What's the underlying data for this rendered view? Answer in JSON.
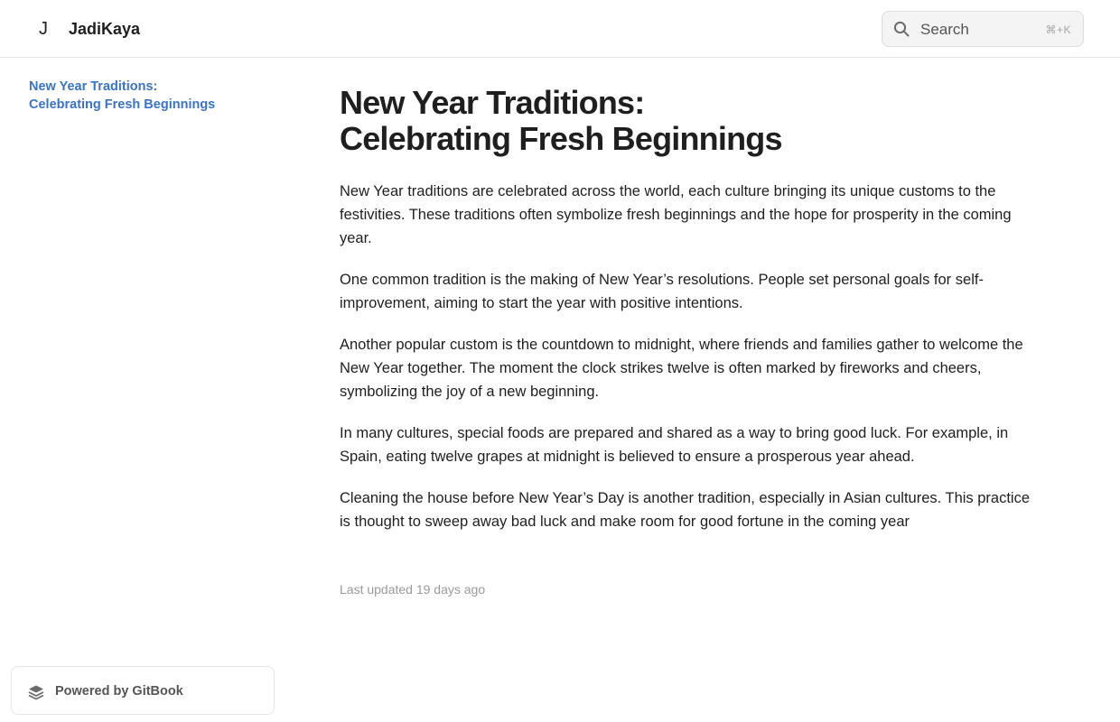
{
  "header": {
    "logo_glyph": "J",
    "site_title": "JadiKaya",
    "search": {
      "placeholder": "Search",
      "shortcut": "⌘+K",
      "icon": "search-icon"
    }
  },
  "sidebar": {
    "active_color": "#3b74c7",
    "items": [
      {
        "label_line1": "New Year Traditions:",
        "label_line2": "Celebrating Fresh Beginnings",
        "active": true
      }
    ],
    "powered_by": {
      "label": "Powered by GitBook",
      "icon": "gitbook-icon"
    }
  },
  "main": {
    "title_line1": "New Year Traditions:",
    "title_line2": "Celebrating Fresh Beginnings",
    "paragraphs": [
      "New Year traditions are celebrated across the world, each culture bringing its unique customs to the festivities. These traditions often symbolize fresh beginnings and the hope for prosperity in the coming year.",
      "One common tradition is the making of New Year’s resolutions. People set personal goals for self-improvement, aiming to start the year with positive intentions.",
      "Another popular custom is the countdown to midnight, where friends and families gather to welcome the New Year together. The moment the clock strikes twelve is often marked by fireworks and cheers, symbolizing the joy of a new beginning.",
      "In many cultures, special foods are prepared and shared as a way to bring good luck. For example, in Spain, eating twelve grapes at midnight is believed to ensure a prosperous year ahead.",
      "Cleaning the house before New Year’s Day is another tradition, especially in Asian cultures. This practice is thought to sweep away bad luck and make room for good fortune in the coming year"
    ],
    "last_updated": "Last updated 19 days ago"
  }
}
